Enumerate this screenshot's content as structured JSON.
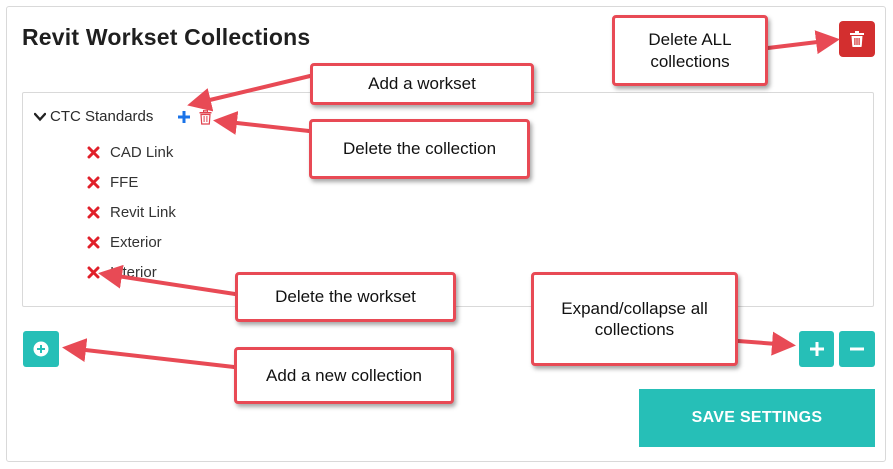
{
  "title": "Revit Workset Collections",
  "collection": {
    "name": "CTC Standards",
    "worksets": [
      "CAD Link",
      "FFE",
      "Revit Link",
      "Exterior",
      "Interior"
    ]
  },
  "buttons": {
    "save_label": "SAVE SETTINGS",
    "add_collection_icon": "plus-circle-icon",
    "expand_all_icon": "plus-icon",
    "collapse_all_icon": "minus-icon",
    "delete_all_icon": "trash-icon"
  },
  "callouts": {
    "delete_all": "Delete ALL\ncollections",
    "add_workset": "Add a workset",
    "delete_collection": "Delete the collection",
    "delete_workset": "Delete the workset",
    "expand_collapse": "Expand/collapse all\ncollections",
    "add_collection": "Add a new collection"
  },
  "colors": {
    "teal": "#26bfb7",
    "red": "#d32f2f",
    "callout_border": "#e84a55",
    "add_blue": "#1a73e8"
  }
}
